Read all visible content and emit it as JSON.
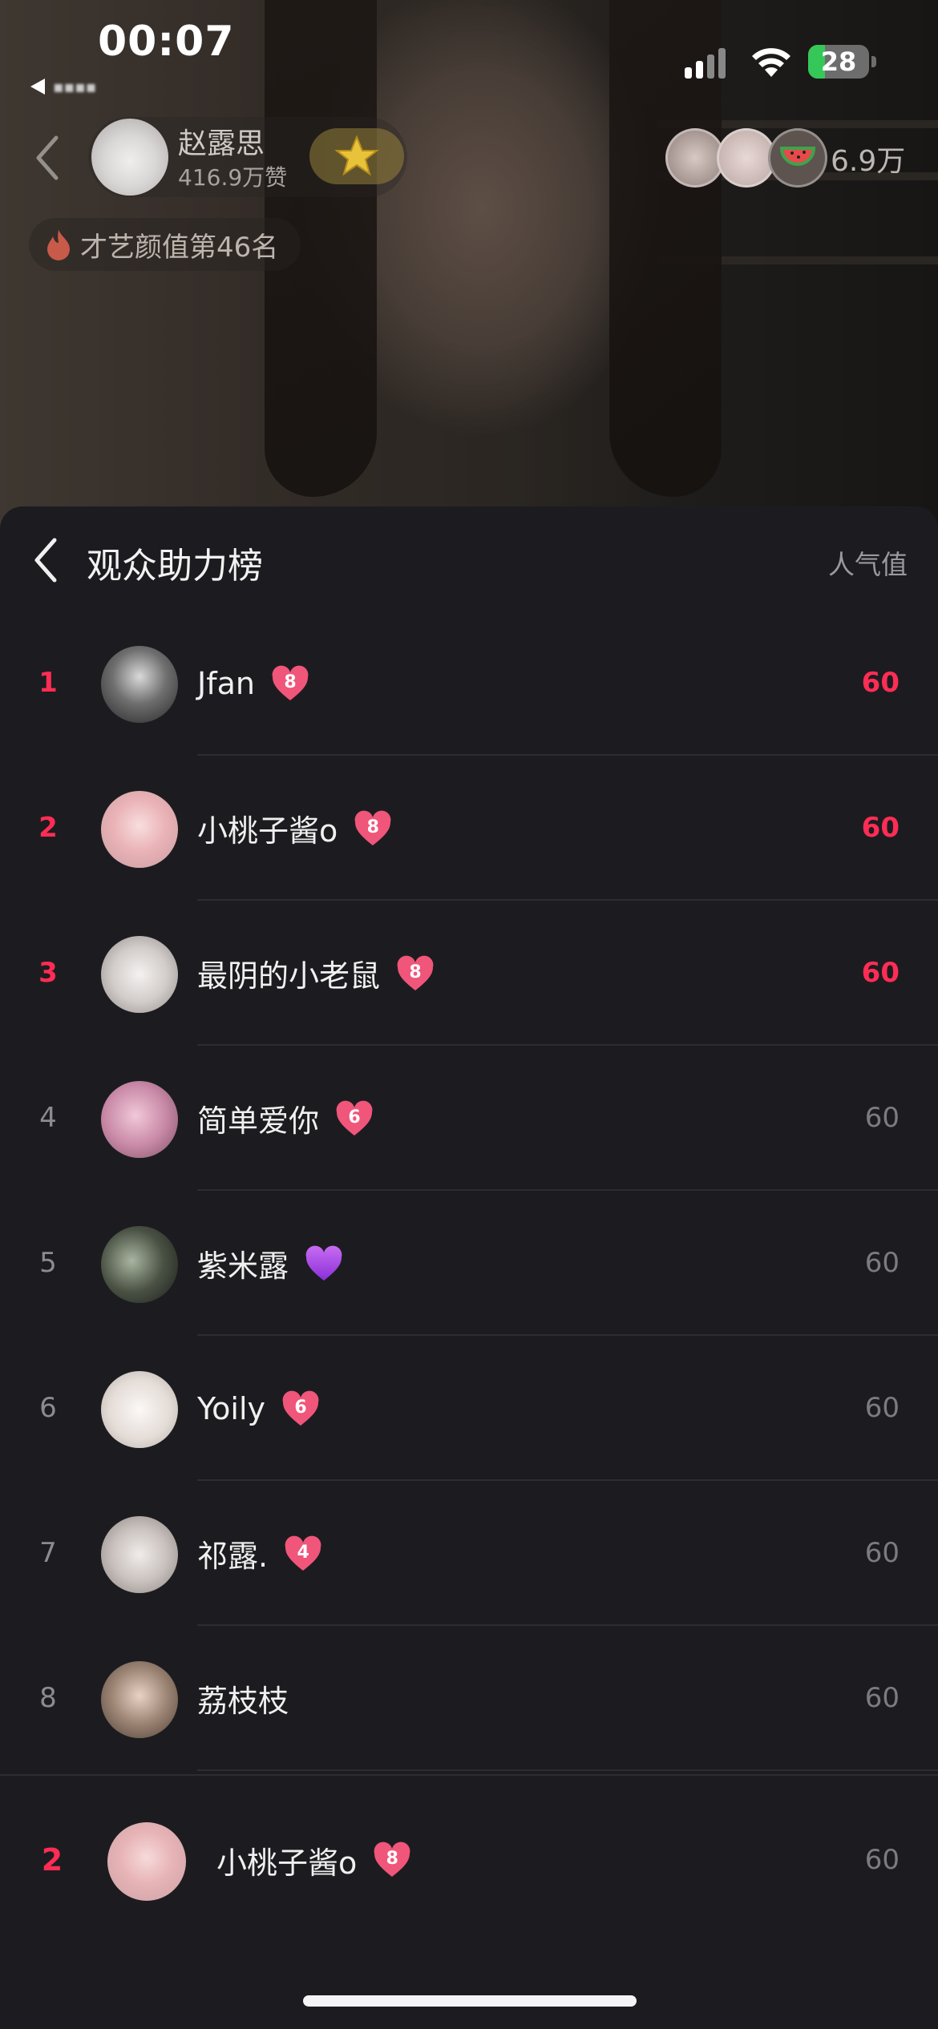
{
  "status_bar": {
    "time": "00:07",
    "back_app_label": "◀",
    "battery": "28",
    "battery_level": 0.28
  },
  "stream_header": {
    "host_name": "赵露思",
    "host_likes": "416.9万赞",
    "viewer_count": "6.9万",
    "rank_text": "才艺颜值第46名"
  },
  "panel": {
    "title": "观众助力榜",
    "sort_label": "人气值"
  },
  "leaderboard": [
    {
      "rank": "1",
      "name": "Jfan",
      "level": "8",
      "score": "60",
      "badge": "heart"
    },
    {
      "rank": "2",
      "name": "小桃子酱o",
      "level": "8",
      "score": "60",
      "badge": "heart"
    },
    {
      "rank": "3",
      "name": "最阴的小老鼠",
      "level": "8",
      "score": "60",
      "badge": "heart"
    },
    {
      "rank": "4",
      "name": "简单爱你",
      "level": "6",
      "score": "60",
      "badge": "heart"
    },
    {
      "rank": "5",
      "name": "紫米露",
      "level": "",
      "score": "60",
      "badge": "purple-heart-emoji"
    },
    {
      "rank": "6",
      "name": "Yoily",
      "level": "6",
      "score": "60",
      "badge": "heart"
    },
    {
      "rank": "7",
      "name": "祁露.",
      "level": "4",
      "score": "60",
      "badge": "heart"
    },
    {
      "rank": "8",
      "name": "荔枝枝",
      "level": "",
      "score": "60",
      "badge": "none"
    }
  ],
  "my_entry": {
    "rank": "2",
    "name": "小桃子酱o",
    "level": "8",
    "score": "60"
  },
  "colors": {
    "accent": "#ff2d55",
    "panel_bg": "#1c1c20",
    "badge_pink": "#f0557a",
    "muted_text": "#7b7b80"
  }
}
